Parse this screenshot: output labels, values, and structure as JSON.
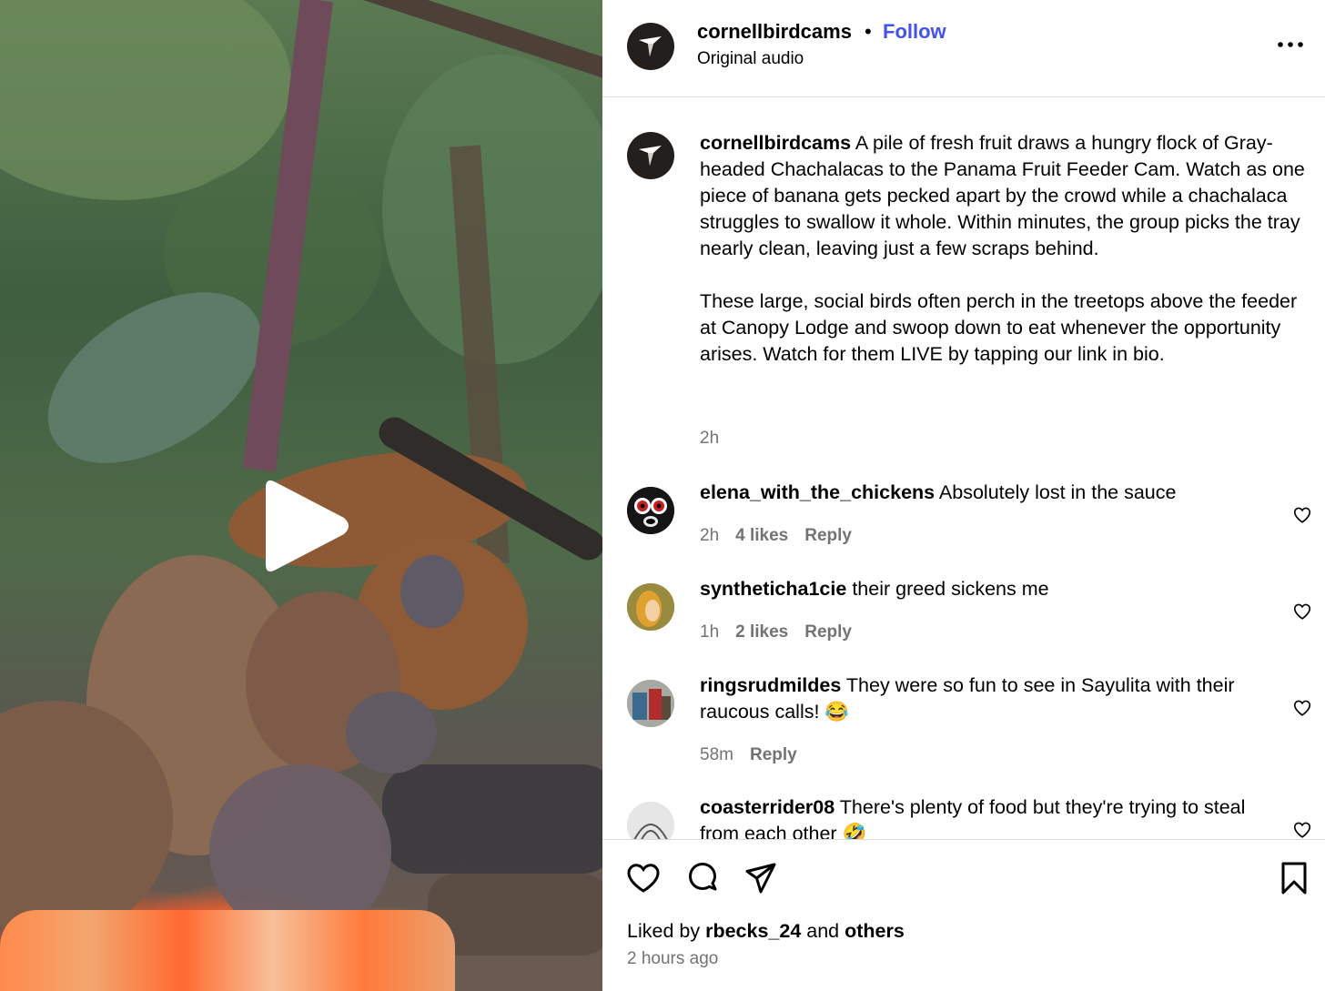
{
  "header": {
    "username": "cornellbirdcams",
    "separator": "•",
    "follow_label": "Follow",
    "audio_label": "Original audio",
    "more_icon": "more-horizontal-icon"
  },
  "video": {
    "play_icon": "play-icon"
  },
  "caption": {
    "username": "cornellbirdcams",
    "paragraph1": "A pile of fresh fruit draws a hungry flock of Gray-headed Chachalacas to the Panama Fruit Feeder Cam. Watch as one piece of banana gets pecked apart by the crowd while a chachalaca struggles to swallow it whole. Within minutes, the group picks the tray nearly clean, leaving just a few scraps behind.",
    "paragraph2": "These large, social birds often perch in the treetops above the feeder at Canopy Lodge and swoop down to eat whenever the opportunity arises. Watch for them LIVE by tapping our link in bio.",
    "time": "2h"
  },
  "comments": [
    {
      "username": "elena_with_the_chickens",
      "text": "Absolutely lost in the sauce",
      "time": "2h",
      "likes": "4 likes",
      "reply": "Reply"
    },
    {
      "username": "syntheticha1cie",
      "text": "their greed sickens me",
      "time": "1h",
      "likes": "2 likes",
      "reply": "Reply"
    },
    {
      "username": "ringsrudmildes",
      "text": "They were so fun to see in Sayulita with their raucous calls! 😂",
      "time": "58m",
      "reply": "Reply"
    },
    {
      "username": "coasterrider08",
      "text": "There's plenty of food but they're trying to steal from each other 🤣"
    }
  ],
  "actions": {
    "like_icon": "heart-icon",
    "comment_icon": "comment-icon",
    "share_icon": "share-icon",
    "save_icon": "bookmark-icon",
    "liked_by_prefix": "Liked by",
    "liked_by_user": "rbecks_24",
    "liked_by_and": "and",
    "liked_by_others": "others",
    "posted": "2 hours ago"
  },
  "colors": {
    "accent": "#4150f7",
    "secondary_text": "#737373",
    "divider": "#dbdbdb"
  }
}
